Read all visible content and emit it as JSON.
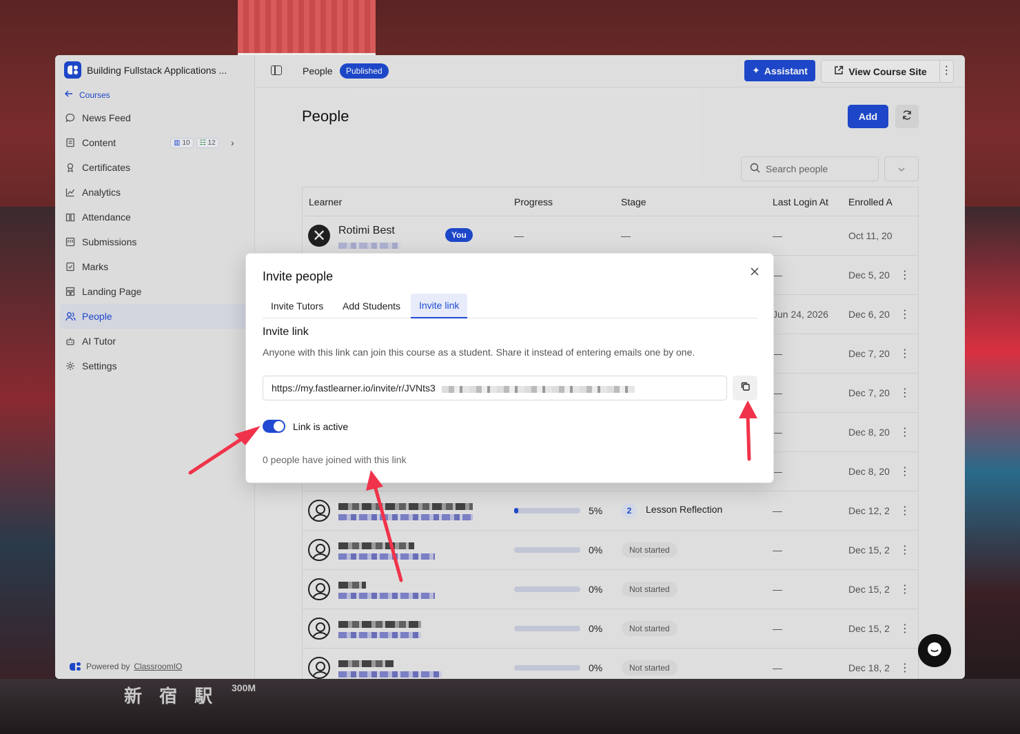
{
  "background_sign": {
    "kanji": "新 宿 駅",
    "distance": "300M"
  },
  "sidebar": {
    "brand_title": "Building Fullstack Applications ...",
    "back_label": "Courses",
    "items": [
      {
        "label": "News Feed",
        "icon": "message-icon"
      },
      {
        "label": "Content",
        "icon": "content-icon",
        "badges": [
          "10",
          "12"
        ]
      },
      {
        "label": "Certificates",
        "icon": "certificate-icon"
      },
      {
        "label": "Analytics",
        "icon": "analytics-icon"
      },
      {
        "label": "Attendance",
        "icon": "attendance-icon"
      },
      {
        "label": "Submissions",
        "icon": "submissions-icon"
      },
      {
        "label": "Marks",
        "icon": "marks-icon"
      },
      {
        "label": "Landing Page",
        "icon": "landing-icon"
      },
      {
        "label": "People",
        "icon": "people-icon",
        "active": true
      },
      {
        "label": "AI Tutor",
        "icon": "robot-icon"
      },
      {
        "label": "Settings",
        "icon": "gear-icon"
      }
    ],
    "powered_prefix": "Powered by",
    "powered_link": "ClassroomIO"
  },
  "topbar": {
    "breadcrumb": "People",
    "status": "Published",
    "assistant_label": "Assistant",
    "view_site_label": "View Course Site",
    "more_label": "⋮"
  },
  "main": {
    "title": "People",
    "add_label": "Add",
    "search_placeholder": "Search people",
    "columns": [
      "Learner",
      "Progress",
      "Stage",
      "Last Login At",
      "Enrolled A"
    ],
    "rows": [
      {
        "name": "Rotimi Best",
        "you": "You",
        "progress": "—",
        "stage": "—",
        "last_login": "—",
        "enrolled": "Oct 11, 20"
      },
      {
        "last_login": "—",
        "enrolled": "Dec 5, 20"
      },
      {
        "last_login": "Jun 24, 2026",
        "enrolled": "Dec 6, 20"
      },
      {
        "last_login": "—",
        "enrolled": "Dec 7, 20"
      },
      {
        "last_login": "—",
        "enrolled": "Dec 7, 20"
      },
      {
        "last_login": "—",
        "enrolled": "Dec 8, 20"
      },
      {
        "last_login": "—",
        "enrolled": "Dec 8, 20"
      },
      {
        "progress_pct": "5%",
        "progress_value": 0.05,
        "stage_num": "2",
        "stage": "Lesson Reflection",
        "last_login": "—",
        "enrolled": "Dec 12, 2"
      },
      {
        "progress_pct": "0%",
        "progress_value": 0,
        "stage": "Not started",
        "last_login": "—",
        "enrolled": "Dec 15, 2"
      },
      {
        "progress_pct": "0%",
        "progress_value": 0,
        "stage": "Not started",
        "last_login": "—",
        "enrolled": "Dec 15, 2"
      },
      {
        "progress_pct": "0%",
        "progress_value": 0,
        "stage": "Not started",
        "last_login": "—",
        "enrolled": "Dec 15, 2"
      },
      {
        "progress_pct": "0%",
        "progress_value": 0,
        "stage": "Not started",
        "last_login": "—",
        "enrolled": "Dec 18, 2"
      }
    ],
    "you_badge": "You"
  },
  "modal": {
    "title": "Invite people",
    "tabs": [
      "Invite Tutors",
      "Add Students",
      "Invite link"
    ],
    "active_tab": "Invite link",
    "section_title": "Invite link",
    "description": "Anyone with this link can join this course as a student. Share it instead of entering emails one by one.",
    "link_value": "https://my.fastlearner.io/invite/r/JVNts3",
    "toggle_label": "Link is active",
    "toggle_on": true,
    "joined_text": "0 people have joined with this link"
  },
  "colors": {
    "accent": "#1f4ad1",
    "annotation_arrow": "#f0334a"
  }
}
